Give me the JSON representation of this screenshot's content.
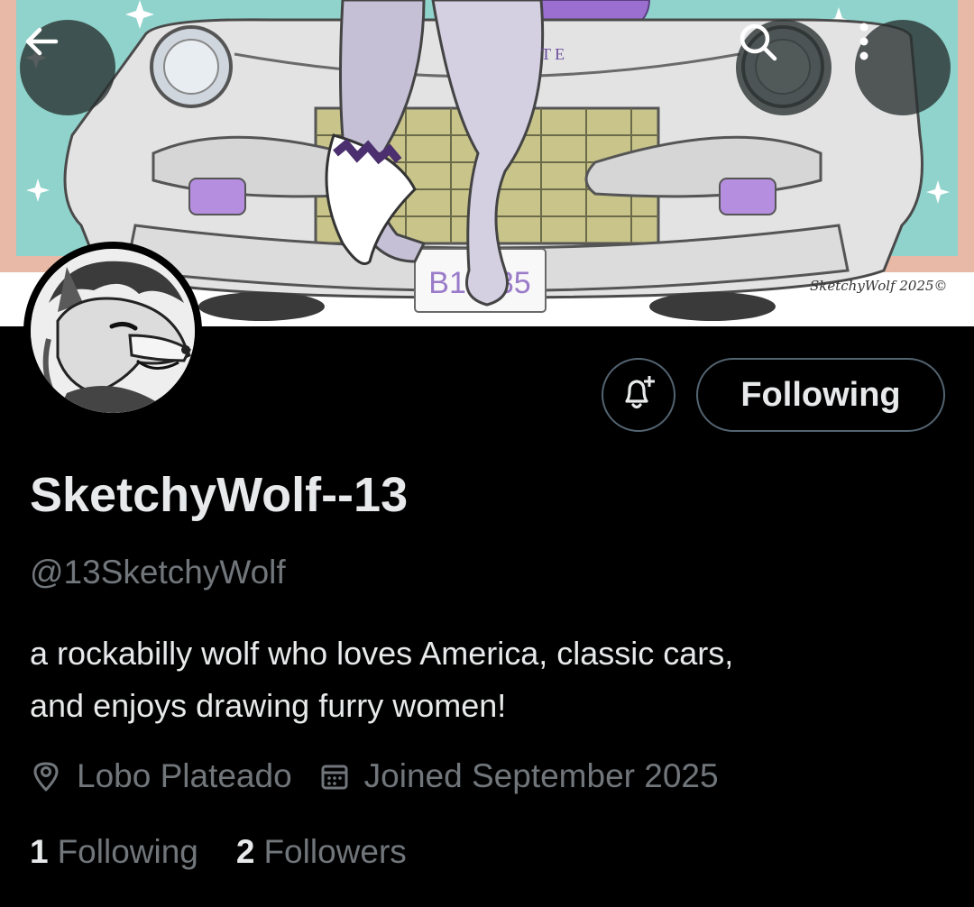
{
  "banner": {
    "plate_text": "B1C  35",
    "signature": "SketchyWolf 2025©",
    "bumper_text": "T E"
  },
  "header_actions": {
    "back_icon": "arrow-left-icon",
    "search_icon": "search-icon",
    "more_icon": "more-vertical-icon"
  },
  "profile": {
    "display_name": "SketchyWolf--13",
    "handle": "@13SketchyWolf",
    "bio_line1": "a rockabilly wolf who loves America, classic cars,",
    "bio_line2": "and enjoys drawing furry women!",
    "location": "Lobo Plateado",
    "joined": "Joined September 2025"
  },
  "actions": {
    "notify_icon": "bell-plus-icon",
    "following_label": "Following"
  },
  "stats": {
    "following_count": "1",
    "following_label": "Following",
    "followers_count": "2",
    "followers_label": "Followers"
  },
  "colors": {
    "background": "#000000",
    "primary_text": "#e7e9ea",
    "secondary_text": "#71767b",
    "border": "#536471",
    "banner_teal": "#8fd3cc",
    "banner_purple": "#9b6fd0"
  }
}
